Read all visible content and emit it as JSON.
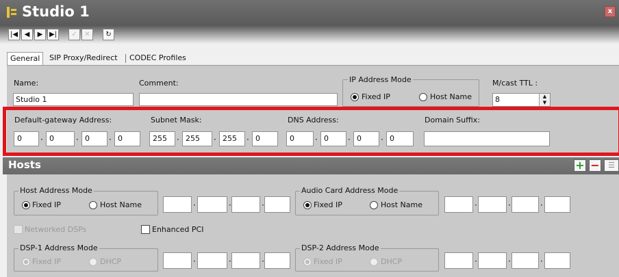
{
  "window": {
    "title": "Studio 1",
    "close_label": "x"
  },
  "toolbar": {
    "buttons": [
      "first",
      "prev",
      "next",
      "last",
      "confirm",
      "cancel",
      "refresh"
    ]
  },
  "tabs": [
    "General",
    "SIP Proxy/Redirect",
    "CODEC Profiles"
  ],
  "general": {
    "name_label": "Name:",
    "name_value": "Studio 1",
    "comment_label": "Comment:",
    "comment_value": "",
    "ip_mode_legend": "IP Address Mode",
    "ip_mode_fixed": "Fixed IP",
    "ip_mode_host": "Host Name",
    "ip_mode_selected": "Fixed IP",
    "mcast_label": "M/cast TTL :",
    "mcast_value": "8",
    "gateway_label": "Default-gateway Address:",
    "gateway": [
      "0",
      "0",
      "0",
      "0"
    ],
    "subnet_label": "Subnet Mask:",
    "subnet": [
      "255",
      "255",
      "255",
      "0"
    ],
    "dns_label": "DNS Address:",
    "dns": [
      "0",
      "0",
      "0",
      "0"
    ],
    "domain_label": "Domain Suffix:",
    "domain_value": ""
  },
  "hosts": {
    "title": "Hosts",
    "host_mode_legend": "Host Address Mode",
    "host_mode_fixed": "Fixed IP",
    "host_mode_host": "Host Name",
    "audio_mode_legend": "Audio Card Address Mode",
    "audio_mode_fixed": "Fixed IP",
    "audio_mode_host": "Host Name",
    "networked_dsps": "Networked DSPs",
    "enhanced_pci": "Enhanced PCI",
    "dsp1_legend": "DSP-1 Address Mode",
    "dsp1_fixed": "Fixed IP",
    "dsp1_dhcp": "DHCP",
    "dsp2_legend": "DSP-2 Address Mode",
    "dsp2_fixed": "Fixed IP",
    "dsp2_dhcp": "DHCP"
  },
  "colors": {
    "highlight": "#e0161c",
    "panel": "#c9c9c9",
    "add": "#2a9d2a",
    "remove": "#d11"
  }
}
